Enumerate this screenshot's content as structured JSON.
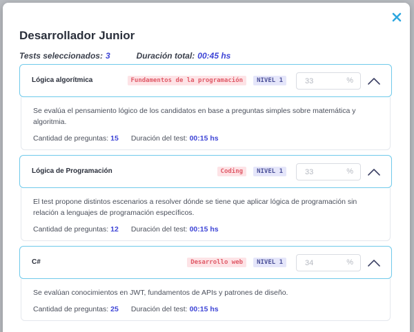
{
  "modal": {
    "title": "Desarrollador Junior",
    "summary": {
      "tests_label": "Tests seleccionados:",
      "tests_value": "3",
      "duration_label": "Duración total:",
      "duration_value": "00:45 hs"
    }
  },
  "colors": {
    "accent": "#3e45d6",
    "card_border": "#6ec9ea",
    "close_icon": "#2ea7e0"
  },
  "labels": {
    "question_count": "Cantidad de preguntas:",
    "test_duration": "Duración del test:",
    "percent_unit": "%"
  },
  "tests": [
    {
      "name": "Lógica algorítmica",
      "category": "Fundamentos de la programación",
      "level": "NIVEL 1",
      "percent": "33",
      "description": "Se evalúa el pensamiento lógico de los candidatos en base a preguntas simples sobre matemática y algoritmia.",
      "questions": "15",
      "duration": "00:15 hs"
    },
    {
      "name": "Lógica de Programación",
      "category": "Coding",
      "level": "NIVEL 1",
      "percent": "33",
      "description": "El test propone distintos escenarios a resolver dónde se tiene que aplicar lógica de programación sin relación a lenguajes de programación específicos.",
      "questions": "12",
      "duration": "00:15 hs"
    },
    {
      "name": "C#",
      "category": "Desarrollo web",
      "level": "NIVEL 1",
      "percent": "34",
      "description": "Se evalúan conocimientos en JWT, fundamentos de APIs y patrones de diseño.",
      "questions": "25",
      "duration": "00:15 hs"
    }
  ]
}
